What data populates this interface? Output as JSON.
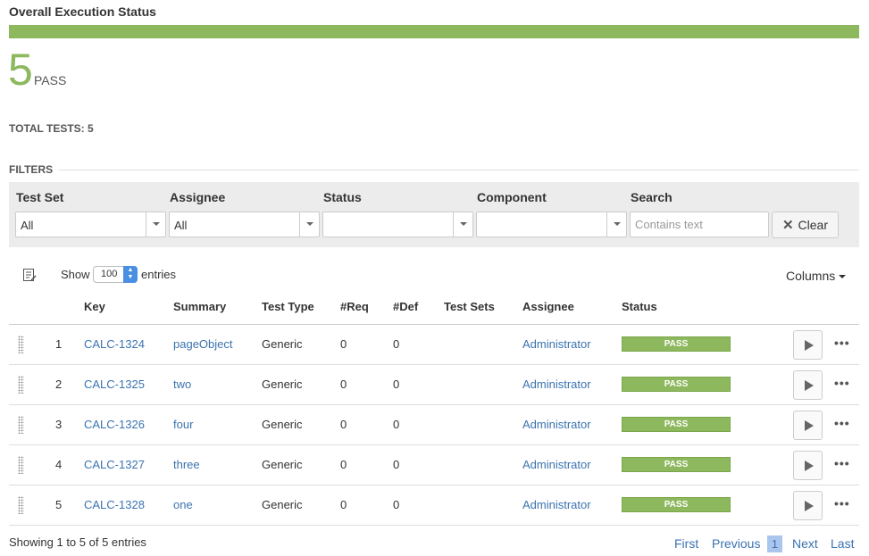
{
  "header": {
    "title": "Overall Execution Status"
  },
  "progress": {
    "pass_fraction": 1.0,
    "color": "#8eb85e"
  },
  "summary": {
    "count": "5",
    "label": "PASS",
    "total": "TOTAL TESTS: 5"
  },
  "filters": {
    "title": "FILTERS",
    "test_set": {
      "label": "Test Set",
      "value": "All"
    },
    "assignee": {
      "label": "Assignee",
      "value": "All"
    },
    "status": {
      "label": "Status",
      "value": ""
    },
    "component": {
      "label": "Component",
      "value": ""
    },
    "search": {
      "label": "Search",
      "placeholder": "Contains text",
      "value": ""
    },
    "clear_label": "Clear"
  },
  "table_controls": {
    "show_label": "Show",
    "entries_value": "100",
    "entries_label": "entries",
    "columns_label": "Columns"
  },
  "table": {
    "headers": [
      "Key",
      "Summary",
      "Test Type",
      "#Req",
      "#Def",
      "Test Sets",
      "Assignee",
      "Status"
    ],
    "rows": [
      {
        "num": "1",
        "key": "CALC-1324",
        "summary": "pageObject",
        "type": "Generic",
        "req": "0",
        "def": "0",
        "sets": "",
        "assignee": "Administrator",
        "status": "PASS"
      },
      {
        "num": "2",
        "key": "CALC-1325",
        "summary": "two",
        "type": "Generic",
        "req": "0",
        "def": "0",
        "sets": "",
        "assignee": "Administrator",
        "status": "PASS"
      },
      {
        "num": "3",
        "key": "CALC-1326",
        "summary": "four",
        "type": "Generic",
        "req": "0",
        "def": "0",
        "sets": "",
        "assignee": "Administrator",
        "status": "PASS"
      },
      {
        "num": "4",
        "key": "CALC-1327",
        "summary": "three",
        "type": "Generic",
        "req": "0",
        "def": "0",
        "sets": "",
        "assignee": "Administrator",
        "status": "PASS"
      },
      {
        "num": "5",
        "key": "CALC-1328",
        "summary": "one",
        "type": "Generic",
        "req": "0",
        "def": "0",
        "sets": "",
        "assignee": "Administrator",
        "status": "PASS"
      }
    ]
  },
  "footer": {
    "info": "Showing 1 to 5 of 5 entries",
    "first": "First",
    "previous": "Previous",
    "current": "1",
    "next": "Next",
    "last": "Last"
  },
  "colors": {
    "pass": "#8eb85e",
    "link": "#3b73af"
  },
  "icons": {
    "list": "list-view-icon",
    "play": "play-icon",
    "more": "more-options-icon",
    "drag": "drag-handle-icon",
    "clear": "close-icon"
  }
}
